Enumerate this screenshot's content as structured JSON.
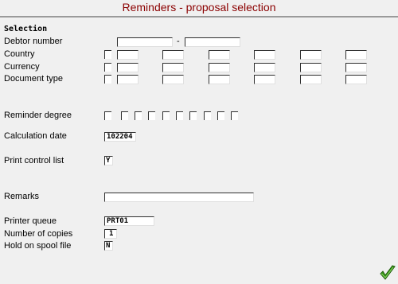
{
  "window": {
    "title": "Reminders - proposal selection"
  },
  "section_label": "Selection",
  "labels": {
    "debtor_number": "Debtor number",
    "country": "Country",
    "currency": "Currency",
    "document_type": "Document type",
    "reminder_degree": "Reminder degree",
    "calculation_date": "Calculation date",
    "print_control_list": "Print control list",
    "remarks": "Remarks",
    "printer_queue": "Printer queue",
    "number_of_copies": "Number of copies",
    "hold_on_spool_file": "Hold on spool file"
  },
  "debtor_range_separator": "-",
  "values": {
    "debtor_from": "",
    "debtor_to": "",
    "calculation_date": "102204",
    "print_control_list": "Y",
    "remarks": "",
    "printer_queue": "PRT01",
    "number_of_copies": "1",
    "hold_on_spool_file": "N"
  },
  "icons": {
    "confirm": "green-checkmark-icon"
  },
  "colors": {
    "title": "#8b0000",
    "background": "#f0f0f0",
    "confirm": "#3a9a1a"
  }
}
